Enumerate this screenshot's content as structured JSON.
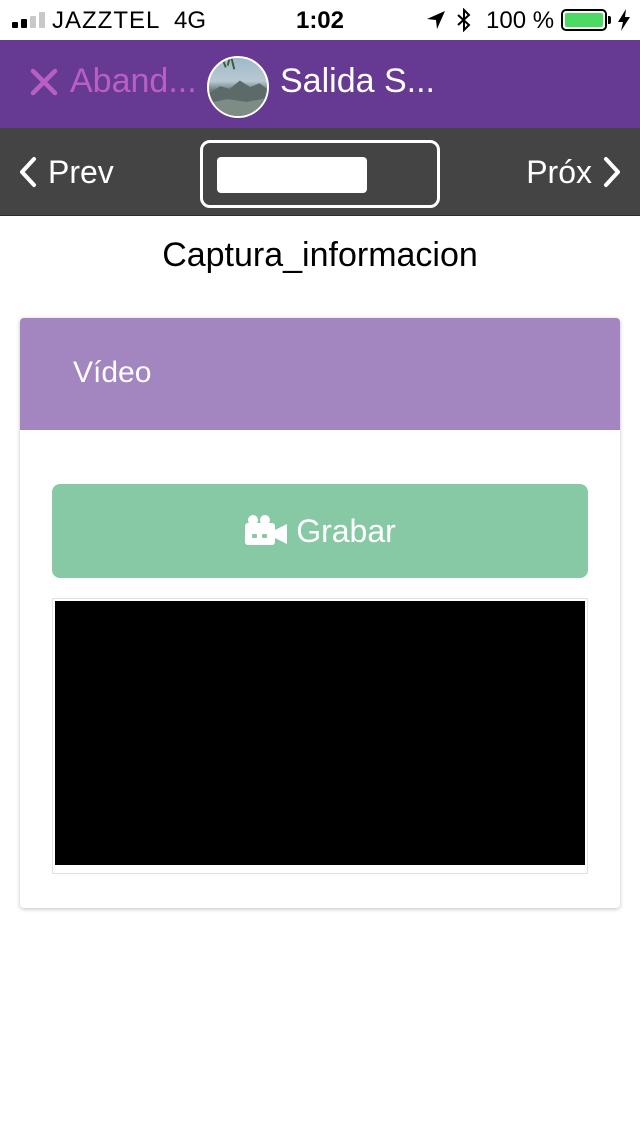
{
  "status_bar": {
    "carrier": "JAZZTEL",
    "network": "4G",
    "time": "1:02",
    "battery": "100 %",
    "battery_color": "#4cd964"
  },
  "header": {
    "abandon_label": "Aband...",
    "title": "Salida S...",
    "background": "#663a92",
    "abandon_color": "#b95fc3"
  },
  "nav": {
    "prev_label": "Prev",
    "next_label": "Próx",
    "page_selector_value": ""
  },
  "page": {
    "heading": "Captura_informacion"
  },
  "card": {
    "title": "Vídeo",
    "header_color": "#a385c0",
    "record_label": "Grabar",
    "record_color": "#88c9a5"
  },
  "icons": {
    "close": "close-icon",
    "prev": "chevron-left-icon",
    "next": "chevron-right-icon",
    "record": "video-camera-icon",
    "location": "location-arrow-icon",
    "bluetooth": "bluetooth-icon",
    "charge": "charging-bolt-icon"
  }
}
